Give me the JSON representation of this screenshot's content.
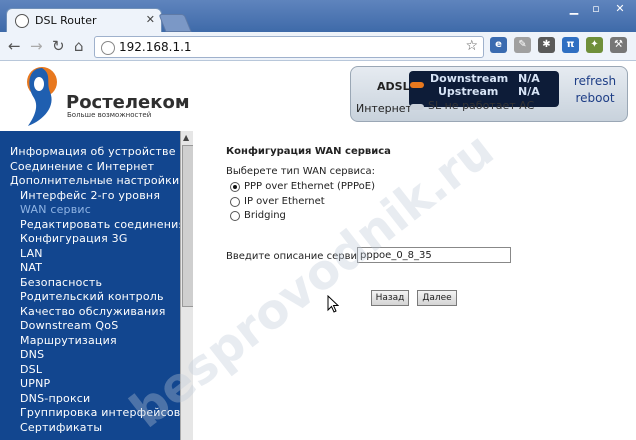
{
  "browser": {
    "tab_title": "DSL Router",
    "url": "192.168.1.1"
  },
  "header": {
    "brand_name": "Ростелеком",
    "slogan": "Больше возможностей"
  },
  "status": {
    "adsl_label": "ADSL",
    "internet_label": "Интернет",
    "downstream_label": "Downstream",
    "upstream_label": "Upstream",
    "downstream_value": "N/A",
    "upstream_value": "N/A",
    "message": "SL не работает АС",
    "refresh_label": "refresh",
    "reboot_label": "reboot",
    "colors": {
      "adsl_led": "#e8781e",
      "internet_led": "#c9d0d8"
    }
  },
  "sidebar": {
    "items": [
      {
        "label": "Информация об устройстве"
      },
      {
        "label": "Соединение с Интернет"
      },
      {
        "label": "Дополнительные настройки"
      },
      {
        "label": "Интерфейс 2-го уровня"
      },
      {
        "label": "WAN сервис"
      },
      {
        "label": "Редактировать соединения"
      },
      {
        "label": "Конфигурация 3G"
      },
      {
        "label": "LAN"
      },
      {
        "label": "NAT"
      },
      {
        "label": "Безопасность"
      },
      {
        "label": "Родительский контроль"
      },
      {
        "label": "Качество обслуживания"
      },
      {
        "label": "Downstream QoS"
      },
      {
        "label": "Маршрутизация"
      },
      {
        "label": "DNS"
      },
      {
        "label": "DSL"
      },
      {
        "label": "UPNP"
      },
      {
        "label": "DNS-прокси"
      },
      {
        "label": "Группировка интерфейсов"
      },
      {
        "label": "Сертификаты"
      }
    ]
  },
  "content": {
    "title": "Конфигурация WAN сервиса",
    "prompt": "Выберете тип WAN сервиса:",
    "options": [
      {
        "label": "PPP over Ethernet (PPPoE)",
        "checked": true
      },
      {
        "label": "IP over Ethernet",
        "checked": false
      },
      {
        "label": "Bridging",
        "checked": false
      }
    ],
    "description_label": "Введите описание сервиса:",
    "description_value": "pppoe_0_8_35",
    "back_label": "Назад",
    "next_label": "Далее"
  },
  "watermark": "besprovodnik.ru"
}
